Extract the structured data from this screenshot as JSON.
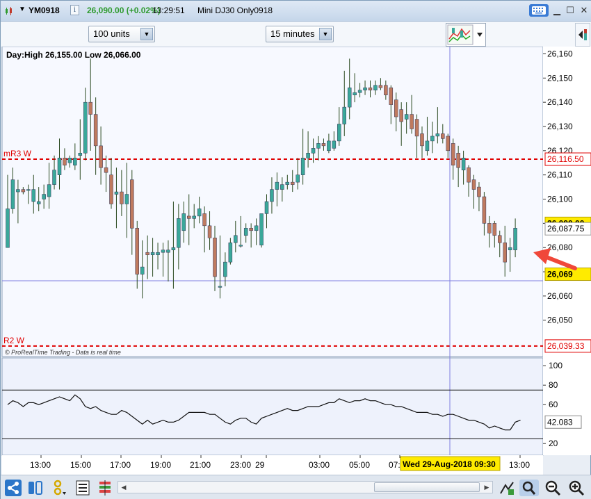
{
  "window": {
    "symbol": "YM0918",
    "price_change": "26,090.00 (+0.02%)",
    "clock": "13:29:51",
    "instrument": "Mini DJ30 Only0918"
  },
  "toolbar": {
    "units": "100 units",
    "timeframe": "15 minutes"
  },
  "colors": {
    "up": "#3aa89a",
    "down": "#bf7a5f",
    "wick": "#2a4a20",
    "bg": "#ffffff",
    "level_red": "#e00000",
    "accent_blue": "#3a7bd5",
    "crosshair": "#7f7fe0",
    "price_tag_yellow": "#ffeb00"
  },
  "chart_data": [
    {
      "type": "candlestick",
      "header": "Day:High 26,155.00 Low 26,066.00",
      "watermark": "© ProRealTime Trading - Data is real time",
      "ylim": [
        26035,
        26163
      ],
      "y_ticks": [
        "26,160",
        "26,150",
        "26,140",
        "26,130",
        "26,120",
        "26,110",
        "26,100",
        "26,090",
        "26,080",
        "26,070",
        "26,060",
        "26,050"
      ],
      "x_ticks": [
        "13:00",
        "15:00",
        "17:00",
        "19:00",
        "21:00",
        "23:00",
        "29",
        "03:00",
        "05:00",
        "07:",
        "13:00"
      ],
      "levels": [
        {
          "label": "mR3 W",
          "value": 26116.5,
          "tag": "26,116.50"
        },
        {
          "label": "R2 W",
          "value": 26039.33,
          "tag": "26,039.33"
        }
      ],
      "price_tags": [
        {
          "value": 26090.0,
          "text": "26,090.00",
          "style": "yellow"
        },
        {
          "value": 26087.75,
          "text": "26,087.75",
          "style": "white"
        },
        {
          "value": 26069,
          "text": "26,069",
          "style": "yellow"
        }
      ],
      "crosshair": {
        "price": 26069,
        "date_label": "Wed 29-Aug-2018 09:30"
      },
      "candles": [
        {
          "o": 26080,
          "h": 26110,
          "l": 26080,
          "c": 26096
        },
        {
          "o": 26096,
          "h": 26113,
          "l": 26094,
          "c": 26108
        },
        {
          "o": 26103,
          "h": 26108,
          "l": 26090,
          "c": 26104
        },
        {
          "o": 26104,
          "h": 26105,
          "l": 26102,
          "c": 26103
        },
        {
          "o": 26104,
          "h": 26106,
          "l": 26098,
          "c": 26104
        },
        {
          "o": 26099,
          "h": 26110,
          "l": 26094,
          "c": 26104
        },
        {
          "o": 26098,
          "h": 26105,
          "l": 26095,
          "c": 26099
        },
        {
          "o": 26100,
          "h": 26106,
          "l": 26096,
          "c": 26102
        },
        {
          "o": 26101,
          "h": 26115,
          "l": 26096,
          "c": 26106
        },
        {
          "o": 26106,
          "h": 26118,
          "l": 26104,
          "c": 26112
        },
        {
          "o": 26110,
          "h": 26125,
          "l": 26104,
          "c": 26117
        },
        {
          "o": 26117,
          "h": 26121,
          "l": 26112,
          "c": 26114
        },
        {
          "o": 26115,
          "h": 26118,
          "l": 26113,
          "c": 26117
        },
        {
          "o": 26114,
          "h": 26123,
          "l": 26112,
          "c": 26117
        },
        {
          "o": 26118,
          "h": 26133,
          "l": 26108,
          "c": 26119
        },
        {
          "o": 26119,
          "h": 26146,
          "l": 26116,
          "c": 26140
        },
        {
          "o": 26140,
          "h": 26158,
          "l": 26120,
          "c": 26135
        },
        {
          "o": 26135,
          "h": 26142,
          "l": 26110,
          "c": 26122
        },
        {
          "o": 26122,
          "h": 26130,
          "l": 26106,
          "c": 26113
        },
        {
          "o": 26113,
          "h": 26118,
          "l": 26103,
          "c": 26111
        },
        {
          "o": 26110,
          "h": 26117,
          "l": 26096,
          "c": 26098
        },
        {
          "o": 26102,
          "h": 26113,
          "l": 26088,
          "c": 26103
        },
        {
          "o": 26103,
          "h": 26112,
          "l": 26093,
          "c": 26098
        },
        {
          "o": 26098,
          "h": 26115,
          "l": 26084,
          "c": 26102
        },
        {
          "o": 26108,
          "h": 26112,
          "l": 26077,
          "c": 26088
        },
        {
          "o": 26088,
          "h": 26091,
          "l": 26063,
          "c": 26069
        },
        {
          "o": 26069,
          "h": 26083,
          "l": 26059,
          "c": 26072
        },
        {
          "o": 26078,
          "h": 26085,
          "l": 26067,
          "c": 26077
        },
        {
          "o": 26077,
          "h": 26084,
          "l": 26068,
          "c": 26078
        },
        {
          "o": 26077,
          "h": 26082,
          "l": 26071,
          "c": 26078
        },
        {
          "o": 26078,
          "h": 26082,
          "l": 26068,
          "c": 26079
        },
        {
          "o": 26078,
          "h": 26083,
          "l": 26066,
          "c": 26079
        },
        {
          "o": 26079,
          "h": 26099,
          "l": 26063,
          "c": 26080
        },
        {
          "o": 26080,
          "h": 26098,
          "l": 26071,
          "c": 26092
        },
        {
          "o": 26087,
          "h": 26099,
          "l": 26082,
          "c": 26094
        },
        {
          "o": 26093,
          "h": 26102,
          "l": 26081,
          "c": 26092
        },
        {
          "o": 26092,
          "h": 26098,
          "l": 26088,
          "c": 26093
        },
        {
          "o": 26093,
          "h": 26101,
          "l": 26090,
          "c": 26096
        },
        {
          "o": 26094,
          "h": 26097,
          "l": 26078,
          "c": 26089
        },
        {
          "o": 26089,
          "h": 26095,
          "l": 26079,
          "c": 26084
        },
        {
          "o": 26084,
          "h": 26089,
          "l": 26062,
          "c": 26068
        },
        {
          "o": 26064,
          "h": 26085,
          "l": 26059,
          "c": 26064
        },
        {
          "o": 26068,
          "h": 26078,
          "l": 26064,
          "c": 26074
        },
        {
          "o": 26074,
          "h": 26084,
          "l": 26073,
          "c": 26082
        },
        {
          "o": 26082,
          "h": 26091,
          "l": 26078,
          "c": 26085
        },
        {
          "o": 26081,
          "h": 26093,
          "l": 26080,
          "c": 26081
        },
        {
          "o": 26085,
          "h": 26090,
          "l": 26082,
          "c": 26088
        },
        {
          "o": 26088,
          "h": 26090,
          "l": 26080,
          "c": 26087
        },
        {
          "o": 26087,
          "h": 26092,
          "l": 26081,
          "c": 26089
        },
        {
          "o": 26081,
          "h": 26093,
          "l": 26080,
          "c": 26094
        },
        {
          "o": 26094,
          "h": 26102,
          "l": 26088,
          "c": 26099
        },
        {
          "o": 26099,
          "h": 26109,
          "l": 26094,
          "c": 26104
        },
        {
          "o": 26104,
          "h": 26111,
          "l": 26097,
          "c": 26107
        },
        {
          "o": 26104,
          "h": 26109,
          "l": 26099,
          "c": 26106
        },
        {
          "o": 26106,
          "h": 26110,
          "l": 26104,
          "c": 26107
        },
        {
          "o": 26107,
          "h": 26112,
          "l": 26103,
          "c": 26106
        },
        {
          "o": 26107,
          "h": 26117,
          "l": 26104,
          "c": 26110
        },
        {
          "o": 26110,
          "h": 26129,
          "l": 26106,
          "c": 26117
        },
        {
          "o": 26117,
          "h": 26128,
          "l": 26113,
          "c": 26119
        },
        {
          "o": 26119,
          "h": 26125,
          "l": 26115,
          "c": 26121
        },
        {
          "o": 26121,
          "h": 26126,
          "l": 26116,
          "c": 26123
        },
        {
          "o": 26123,
          "h": 26125,
          "l": 26120,
          "c": 26122
        },
        {
          "o": 26120,
          "h": 26127,
          "l": 26119,
          "c": 26124
        },
        {
          "o": 26121,
          "h": 26128,
          "l": 26120,
          "c": 26124
        },
        {
          "o": 26124,
          "h": 26138,
          "l": 26122,
          "c": 26131
        },
        {
          "o": 26131,
          "h": 26153,
          "l": 26126,
          "c": 26138
        },
        {
          "o": 26138,
          "h": 26158,
          "l": 26133,
          "c": 26146
        },
        {
          "o": 26143,
          "h": 26152,
          "l": 26140,
          "c": 26144
        },
        {
          "o": 26144,
          "h": 26148,
          "l": 26142,
          "c": 26145
        },
        {
          "o": 26145,
          "h": 26149,
          "l": 26143,
          "c": 26146
        },
        {
          "o": 26146,
          "h": 26149,
          "l": 26142,
          "c": 26145
        },
        {
          "o": 26145,
          "h": 26149,
          "l": 26143,
          "c": 26147
        },
        {
          "o": 26147,
          "h": 26150,
          "l": 26145,
          "c": 26146
        },
        {
          "o": 26147,
          "h": 26149,
          "l": 26141,
          "c": 26143
        },
        {
          "o": 26146,
          "h": 26147,
          "l": 26131,
          "c": 26139
        },
        {
          "o": 26141,
          "h": 26144,
          "l": 26128,
          "c": 26134
        },
        {
          "o": 26137,
          "h": 26140,
          "l": 26122,
          "c": 26132
        },
        {
          "o": 26133,
          "h": 26140,
          "l": 26127,
          "c": 26135
        },
        {
          "o": 26135,
          "h": 26143,
          "l": 26127,
          "c": 26129
        },
        {
          "o": 26133,
          "h": 26135,
          "l": 26117,
          "c": 26126
        },
        {
          "o": 26127,
          "h": 26130,
          "l": 26117,
          "c": 26122
        },
        {
          "o": 26120,
          "h": 26134,
          "l": 26118,
          "c": 26124
        },
        {
          "o": 26124,
          "h": 26132,
          "l": 26119,
          "c": 26126
        },
        {
          "o": 26126,
          "h": 26138,
          "l": 26123,
          "c": 26127
        },
        {
          "o": 26127,
          "h": 26131,
          "l": 26123,
          "c": 26125
        },
        {
          "o": 26126,
          "h": 26127,
          "l": 26117,
          "c": 26120
        },
        {
          "o": 26123,
          "h": 26125,
          "l": 26108,
          "c": 26114
        },
        {
          "o": 26119,
          "h": 26122,
          "l": 26105,
          "c": 26113
        },
        {
          "o": 26112,
          "h": 26120,
          "l": 26106,
          "c": 26117
        },
        {
          "o": 26113,
          "h": 26114,
          "l": 26101,
          "c": 26107
        },
        {
          "o": 26108,
          "h": 26110,
          "l": 26096,
          "c": 26104
        },
        {
          "o": 26105,
          "h": 26107,
          "l": 26095,
          "c": 26101
        },
        {
          "o": 26101,
          "h": 26103,
          "l": 26085,
          "c": 26090
        },
        {
          "o": 26090,
          "h": 26093,
          "l": 26080,
          "c": 26086
        },
        {
          "o": 26090,
          "h": 26091,
          "l": 26080,
          "c": 26085
        },
        {
          "o": 26085,
          "h": 26087,
          "l": 26076,
          "c": 26082
        },
        {
          "o": 26082,
          "h": 26089,
          "l": 26068,
          "c": 26074
        },
        {
          "o": 26079,
          "h": 26084,
          "l": 26070,
          "c": 26080
        },
        {
          "o": 26079,
          "h": 26092,
          "l": 26076,
          "c": 26088
        }
      ]
    },
    {
      "type": "line",
      "ylim": [
        8,
        108
      ],
      "y_ticks": [
        "100",
        "80",
        "60",
        "20"
      ],
      "thresholds": [
        75,
        25
      ],
      "last_value": "42.083",
      "values": [
        60,
        64,
        62,
        58,
        62,
        62,
        60,
        62,
        64,
        66,
        68,
        66,
        64,
        70,
        66,
        58,
        56,
        58,
        54,
        52,
        50,
        50,
        54,
        52,
        48,
        44,
        40,
        44,
        40,
        42,
        44,
        42,
        42,
        44,
        48,
        52,
        52,
        52,
        52,
        50,
        50,
        46,
        42,
        40,
        44,
        46,
        46,
        42,
        40,
        46,
        48,
        50,
        52,
        54,
        56,
        54,
        54,
        56,
        58,
        58,
        58,
        60,
        62,
        62,
        66,
        64,
        62,
        64,
        64,
        66,
        64,
        64,
        62,
        60,
        60,
        58,
        58,
        56,
        54,
        52,
        52,
        52,
        50,
        50,
        48,
        50,
        50,
        48,
        46,
        44,
        44,
        42,
        40,
        36,
        38,
        36,
        34,
        34,
        42,
        44
      ]
    }
  ],
  "bottombar": {}
}
